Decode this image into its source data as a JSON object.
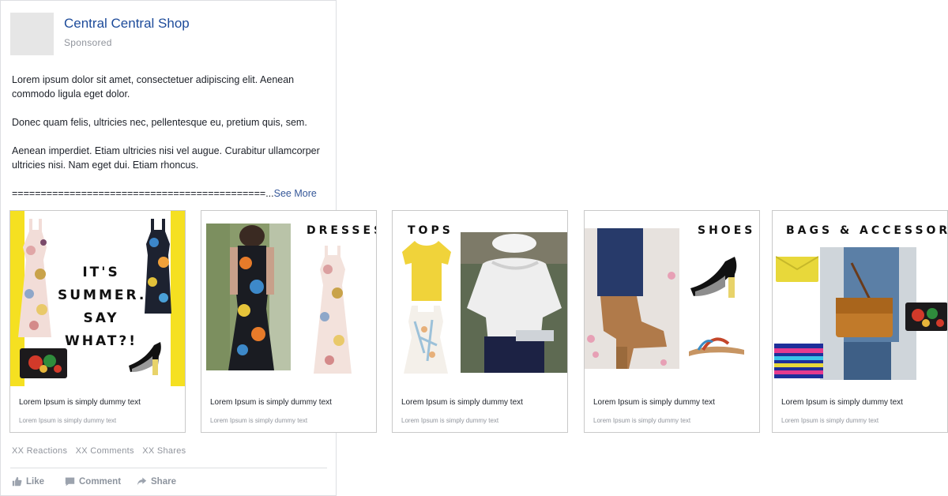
{
  "post": {
    "page_name": "Central Central Shop",
    "sponsored": "Sponsored",
    "paragraphs": [
      "Lorem ipsum dolor sit amet, consectetuer adipiscing elit. Aenean commodo ligula eget dolor.",
      "Donec quam felis, ultricies nec, pellentesque eu, pretium quis, sem.",
      "Aenean imperdiet. Etiam ultricies nisi vel augue. Curabitur ullamcorper ultricies nisi. Nam eget dui. Etiam rhoncus."
    ],
    "truncated_line": "============================================...",
    "see_more": "See More"
  },
  "stats": {
    "reactions": "XX Reactions",
    "comments": "XX Comments",
    "shares": "XX Shares"
  },
  "actions": {
    "like": "Like",
    "comment": "Comment",
    "share": "Share"
  },
  "cards": [
    {
      "summer_lines": [
        "IT'S",
        "SUMMER.",
        "SAY",
        "WHAT?!"
      ],
      "title": "Lorem Ipsum is simply dummy text",
      "desc": "Lorem Ipsum is simply dummy text"
    },
    {
      "headline": "DRESSES",
      "title": "Lorem Ipsum is simply dummy text",
      "desc": "Lorem Ipsum is simply dummy text"
    },
    {
      "headline": "TOPS",
      "title": "Lorem Ipsum is simply dummy text",
      "desc": "Lorem Ipsum is simply dummy text"
    },
    {
      "headline": "SHOES",
      "title": "Lorem Ipsum is simply dummy text",
      "desc": "Lorem Ipsum is simply dummy text"
    },
    {
      "headline": "BAGS & ACCESSORIES",
      "title": "Lorem Ipsum is simply dummy text",
      "desc": "Lorem Ipsum is simply dummy text"
    }
  ],
  "colors": {
    "link_blue": "#365899",
    "page_name_blue": "#1d4b9a",
    "meta_gray": "#90949c",
    "accent_yellow": "#f5e021"
  }
}
